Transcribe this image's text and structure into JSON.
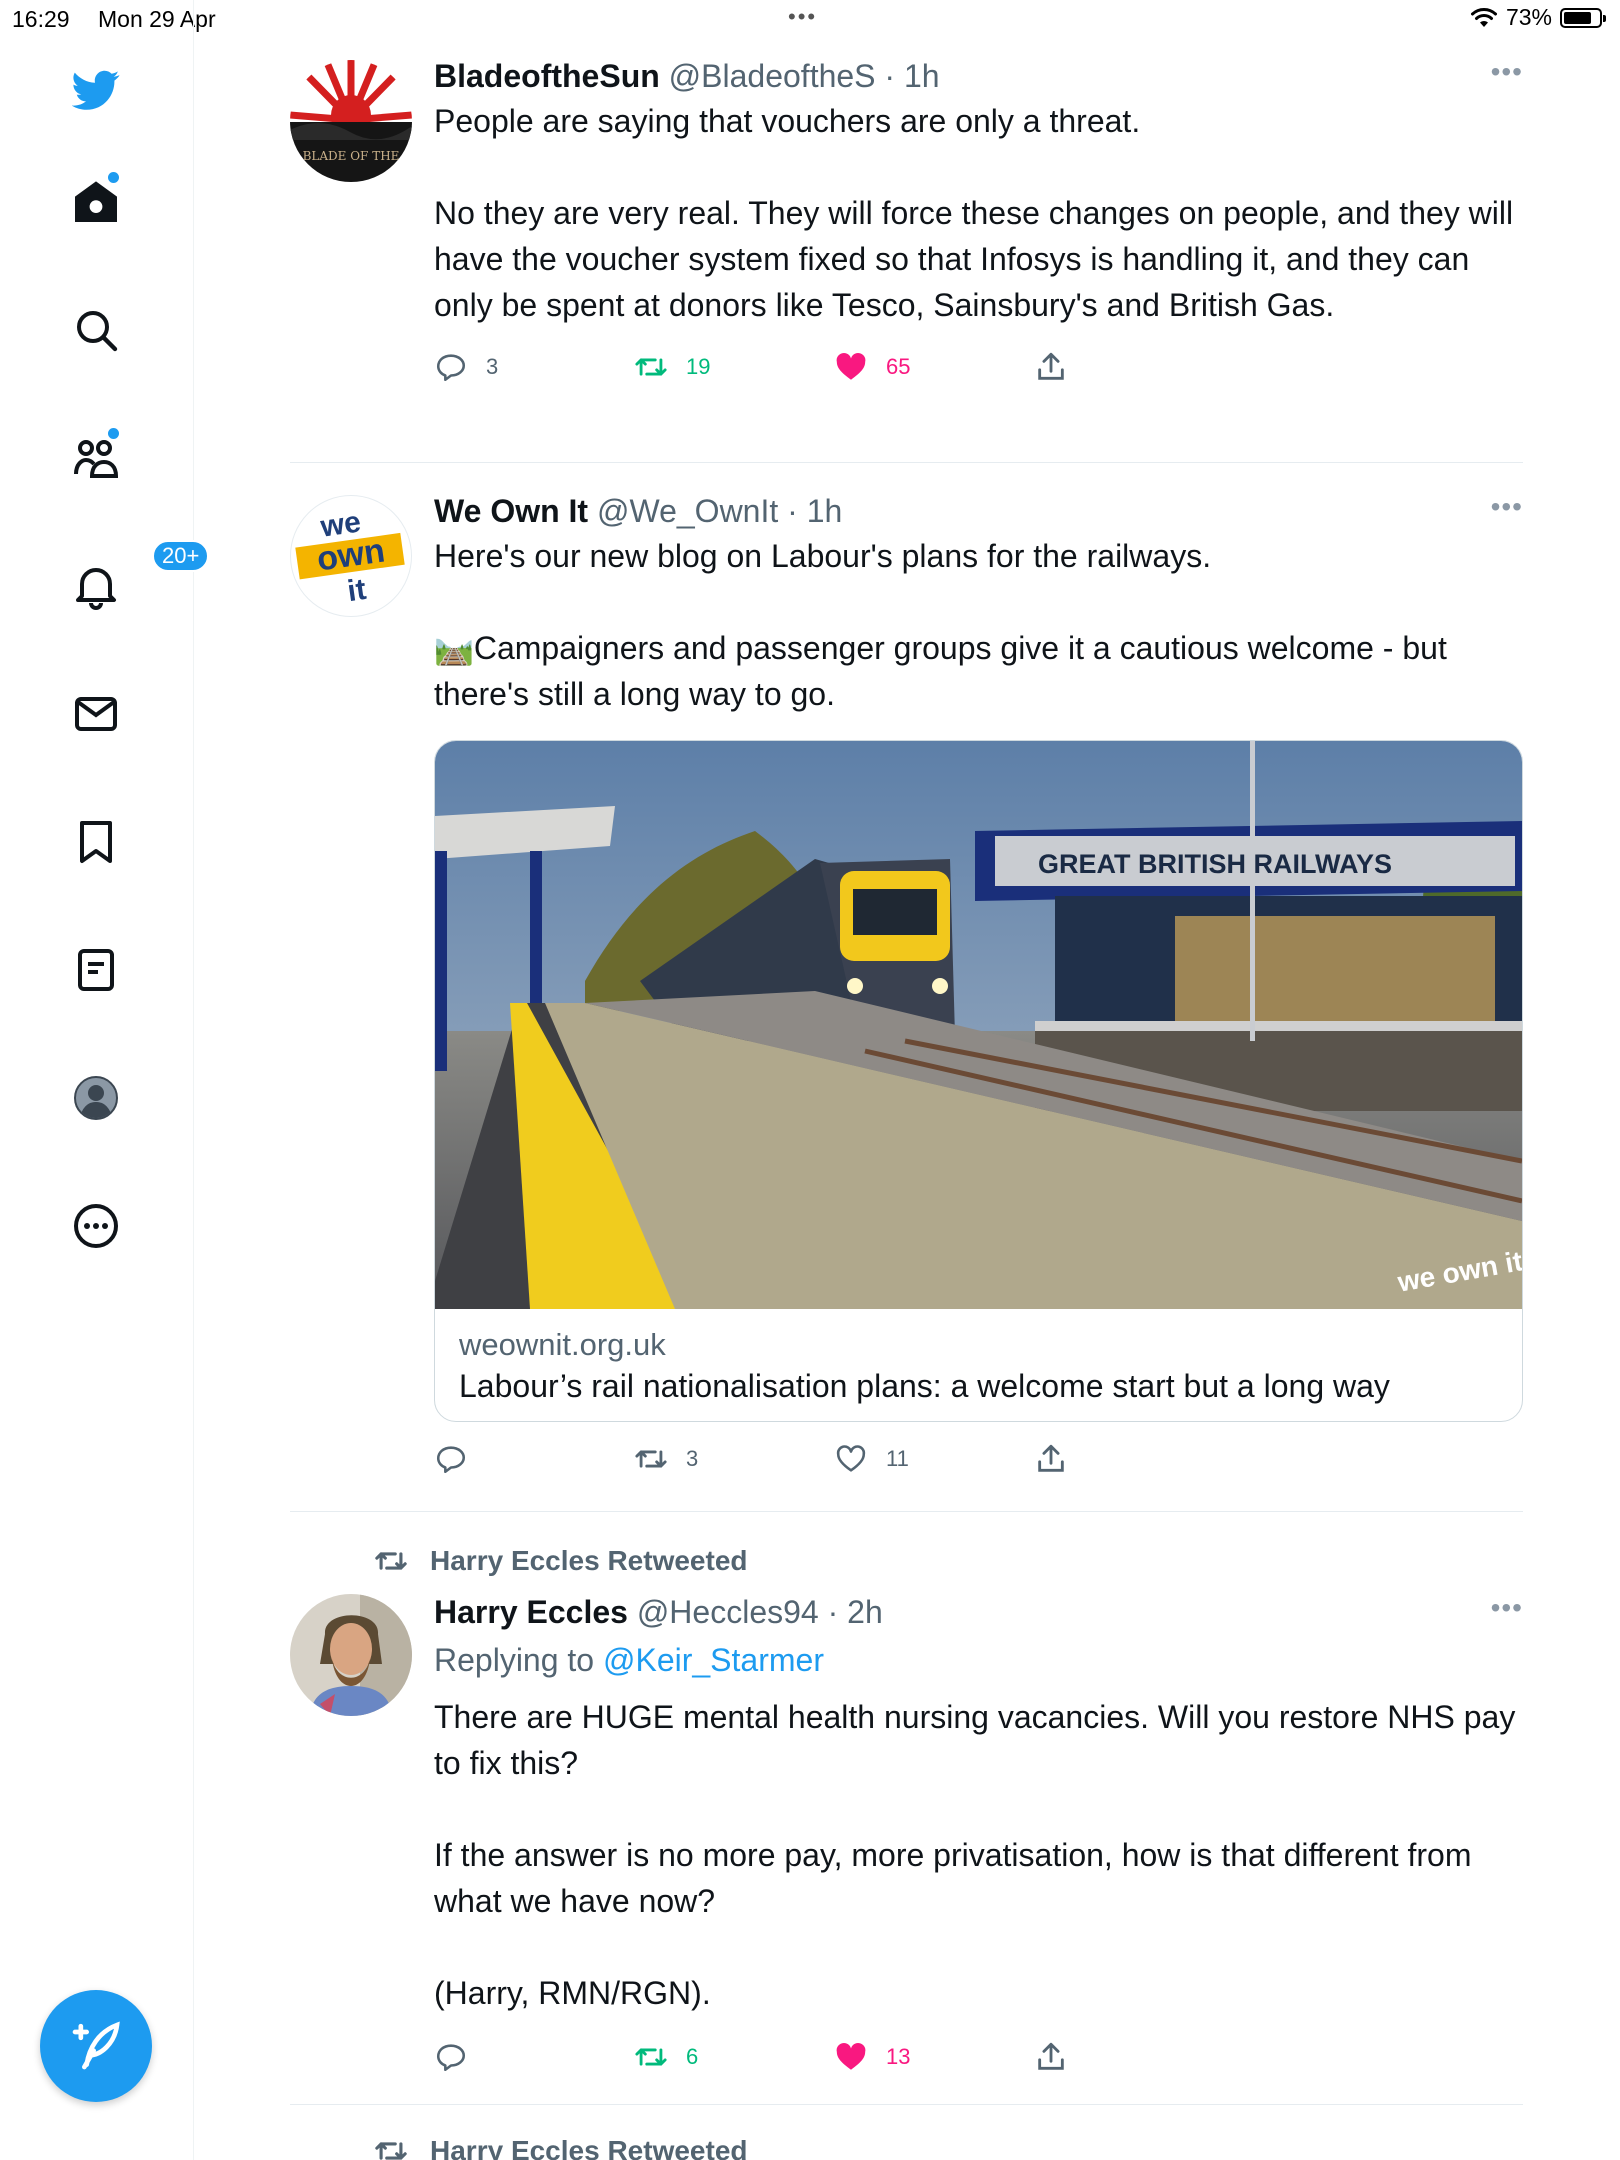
{
  "status_bar": {
    "time": "16:29",
    "date": "Mon 29 Apr",
    "more": "•••",
    "battery": "73%"
  },
  "sidebar": {
    "notifications_badge": "20+"
  },
  "tweets": [
    {
      "name": "BladeoftheSun",
      "handle": "@BladeoftheS",
      "time": "· 1h",
      "more": "•••",
      "avatar_text": "BLADE OF THE",
      "text": "People are saying that vouchers are only a threat.\n\nNo they are very real. They will force these changes on people, and they will have the voucher system fixed so that Infosys is handling it, and they can only be spent at donors like Tesco, Sainsbury's and British Gas.",
      "replies": "3",
      "retweets": "19",
      "likes": "65"
    },
    {
      "name": "We Own It",
      "handle": "@We_OwnIt",
      "time": "· 1h",
      "more": "•••",
      "avatar_lines": [
        "we",
        "own",
        "it"
      ],
      "text": "Here's our new blog on Labour's plans for the railways.\n\n🛤️Campaigners and passenger groups give it a cautious welcome - but there's still a long way to go.",
      "card": {
        "station_sign": "GREAT BRITISH RAILWAYS",
        "watermark": "we own it",
        "domain": "weownit.org.uk",
        "title": "Labour’s rail nationalisation plans: a welcome start but a long way"
      },
      "replies": "",
      "retweets": "3",
      "likes": "11"
    },
    {
      "retweeted_by": "Harry Eccles Retweeted",
      "name": "Harry Eccles",
      "handle": "@Heccles94",
      "time": "· 2h",
      "more": "•••",
      "replying_prefix": "Replying to",
      "replying_to": "@Keir_Starmer",
      "text": "There are HUGE mental health nursing vacancies. Will you restore NHS pay to fix this?\n\nIf the answer is no more pay, more privatisation, how is that different from what we have now?\n\n(Harry, RMN/RGN).",
      "replies": "",
      "retweets": "6",
      "likes": "13"
    },
    {
      "retweeted_by": "Harry Eccles Retweeted"
    }
  ],
  "colors": {
    "accent": "#1d9bf0",
    "retweet_green": "#00ba7c",
    "like_pink": "#f91880",
    "text": "#0f1419",
    "secondary": "#536471"
  }
}
